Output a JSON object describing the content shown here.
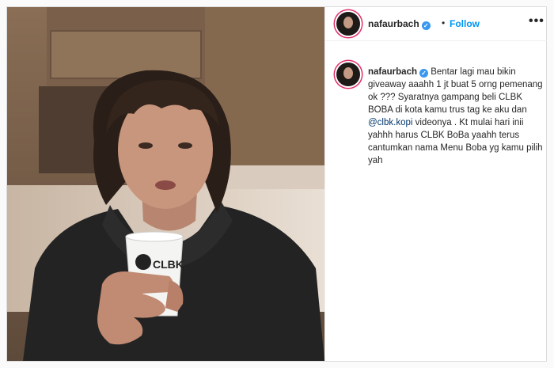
{
  "post": {
    "username": "nafaurbach",
    "verified": true,
    "follow_label": "Follow",
    "separator": "•",
    "more_label": "•••",
    "caption": {
      "part1": "Bentar lagi mau bikin giveaway aaahh 1 jt buat 5 orng pemenang ok ??? Syaratnya gampang beli CLBK BOBA di kota kamu trus tag ke aku dan ",
      "mention": "@clbk.kopi",
      "part2": " videonya . Kt mulai hari inii yahhh harus CLBK BoBa yaahh terus cantumkan nama Menu Boba yg kamu pilih yah"
    },
    "cup_logo_text": "CLBK"
  },
  "colors": {
    "link": "#0095f6",
    "verified": "#3897f0",
    "text": "#262626"
  },
  "icons": {
    "verified": "verified-badge-icon",
    "more": "more-options-icon"
  }
}
